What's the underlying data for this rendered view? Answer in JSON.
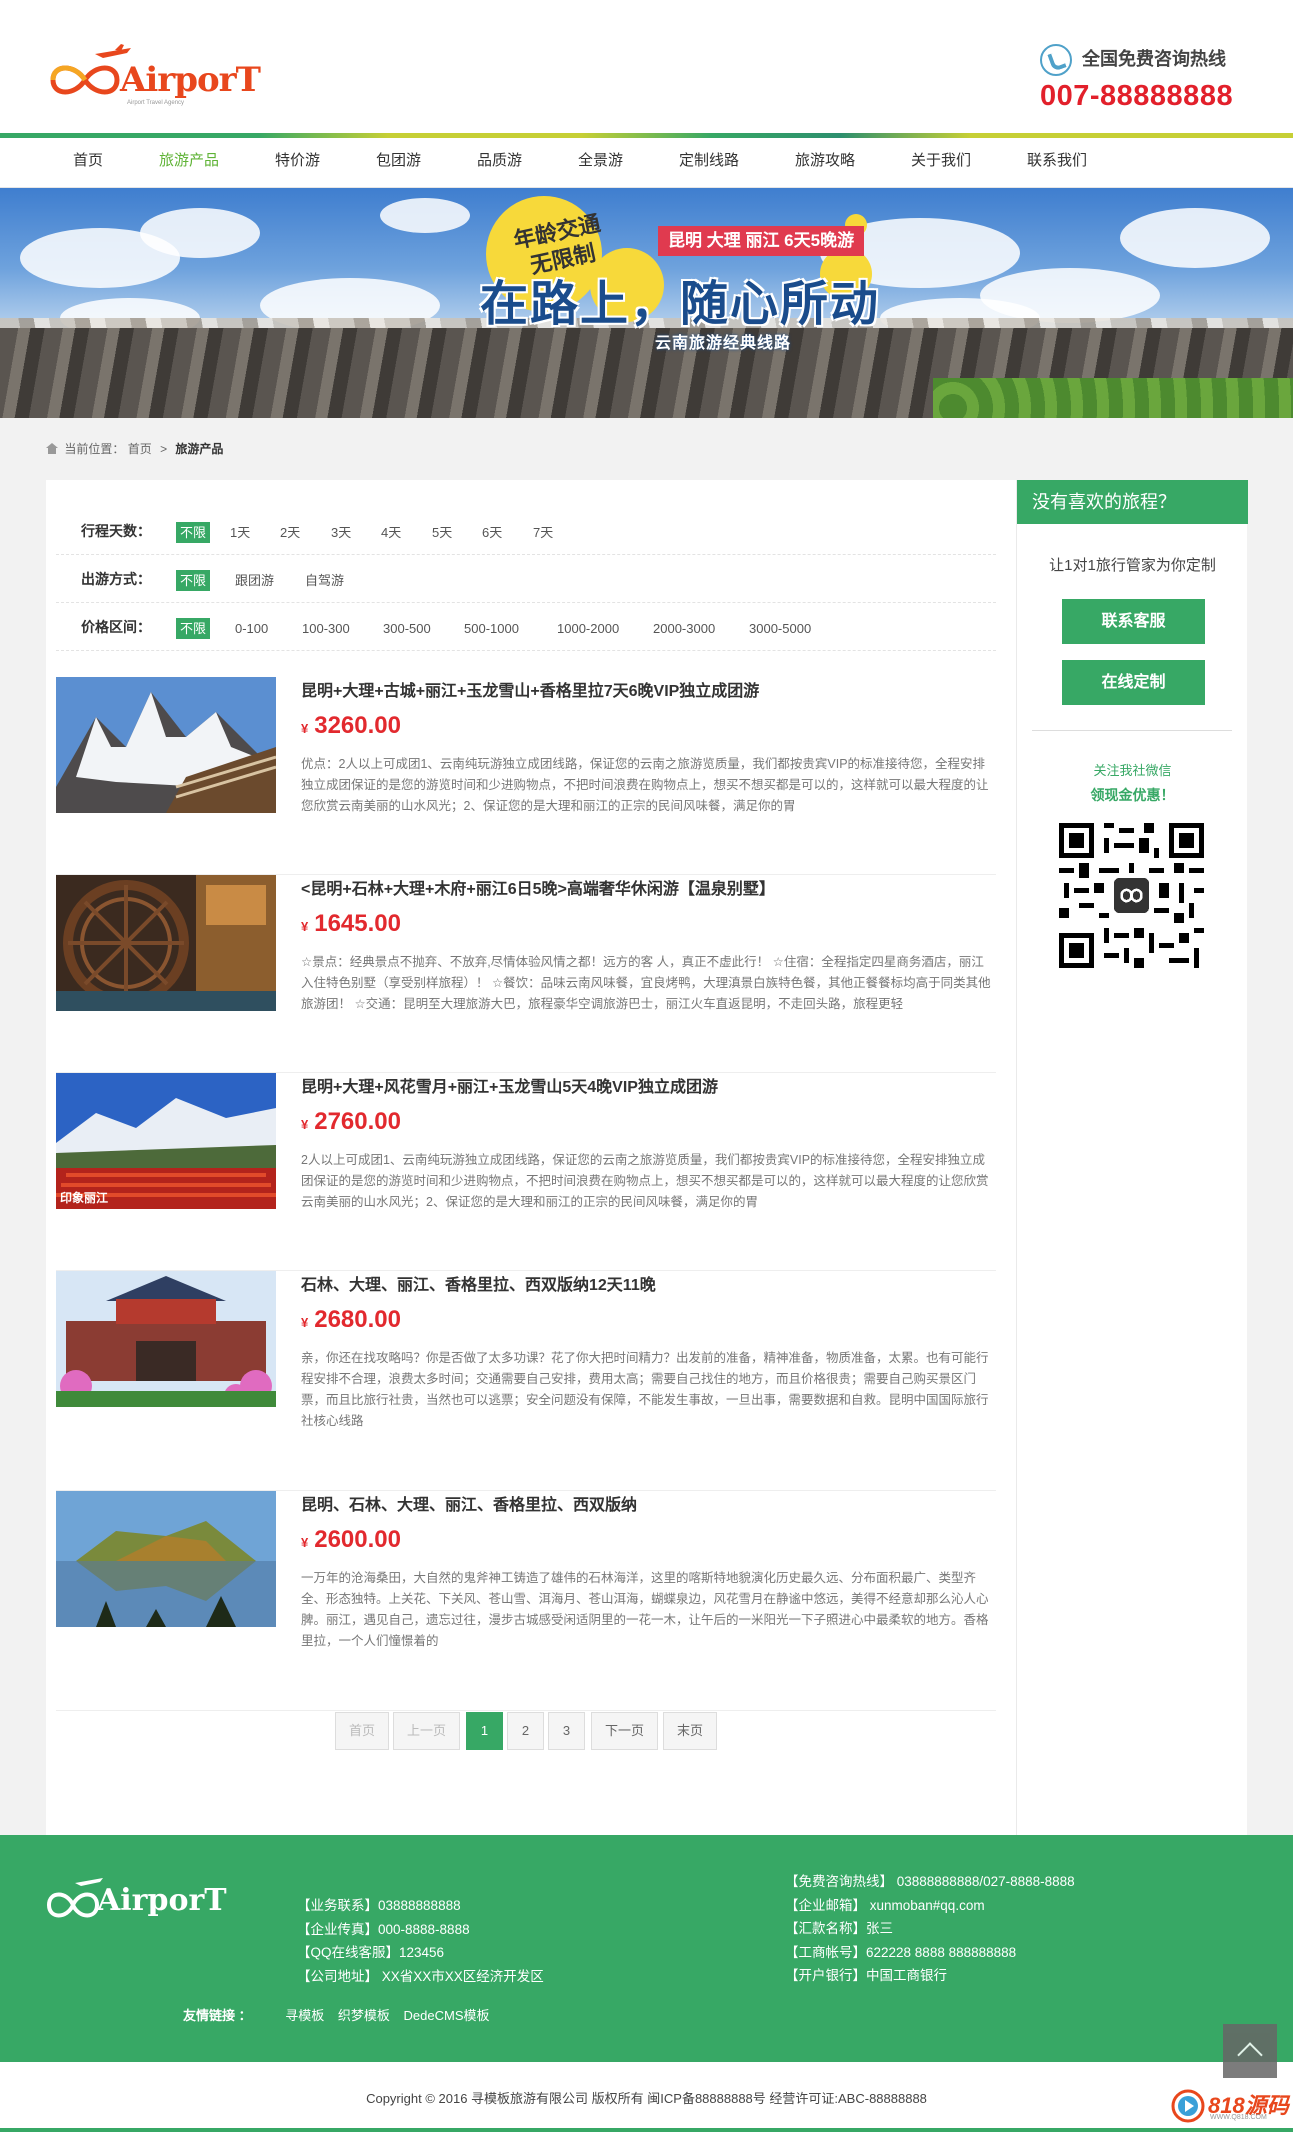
{
  "brand": {
    "logo_text": "AirporT",
    "logo_sub": "Airport Travel Agency",
    "footer_logo_text": "AirporT"
  },
  "header": {
    "hotline_label": "全国免费咨询热线",
    "hotline_number": "007-88888888"
  },
  "nav": [
    "首页",
    "旅游产品",
    "特价游",
    "包团游",
    "品质游",
    "全景游",
    "定制线路",
    "旅游攻略",
    "关于我们",
    "联系我们"
  ],
  "nav_active": "旅游产品",
  "banner": {
    "tag_line1": "年龄交通",
    "tag_line2": "无限制",
    "red_tag": "昆明 大理 丽江 6天5晚游",
    "main_title": "在路上，随心所动",
    "subtitle": "云南旅游经典线路"
  },
  "breadcrumb": {
    "prefix": "当前位置：",
    "home": "首页",
    "sep": ">",
    "current": "旅游产品"
  },
  "filters": [
    {
      "label": "行程天数：",
      "options": [
        "不限",
        "1天",
        "2天",
        "3天",
        "4天",
        "5天",
        "6天",
        "7天"
      ]
    },
    {
      "label": "出游方式：",
      "options": [
        "不限",
        "跟团游",
        "自驾游"
      ]
    },
    {
      "label": "价格区间：",
      "options": [
        "不限",
        "0-100",
        "100-300",
        "300-500",
        "500-1000",
        "1000-2000",
        "2000-3000",
        "3000-5000"
      ]
    }
  ],
  "products": [
    {
      "title": "昆明+大理+古城+丽江+玉龙雪山+香格里拉7天6晚VIP独立成团游",
      "currency": "¥",
      "price": "3260.00",
      "desc": "优点：2人以上可成团1、云南纯玩游独立成团线路，保证您的云南之旅游览质量，我们都按贵宾VIP的标准接待您，全程安排独立成团保证的是您的游览时间和少进购物点，不把时间浪费在购物点上，想买不想买都是可以的，这样就可以最大程度的让您欣赏云南美丽的山水风光；2、保证您的是大理和丽江的正宗的民间风味餐，满足你的胃"
    },
    {
      "title": "<昆明+石林+大理+木府+丽江6日5晚>高端奢华休闲游【温泉别墅】",
      "currency": "¥",
      "price": "1645.00",
      "desc": "☆景点：经典景点不抛弃、不放弃,尽情体验风情之都！远方的客 人，真正不虚此行！ ☆住宿：全程指定四星商务酒店，丽江入住特色别墅（享受别样旅程）！ ☆餐饮：品味云南风味餐，宜良烤鸭，大理滇景白族特色餐，其他正餐餐标均高于同类其他旅游团！ ☆交通：昆明至大理旅游大巴，旅程豪华空调旅游巴士，丽江火车直返昆明，不走回头路，旅程更轻"
    },
    {
      "title": "昆明+大理+风花雪月+丽江+玉龙雪山5天4晚VIP独立成团游",
      "currency": "¥",
      "price": "2760.00",
      "desc": "2人以上可成团1、云南纯玩游独立成团线路，保证您的云南之旅游览质量，我们都按贵宾VIP的标准接待您，全程安排独立成团保证的是您的游览时间和少进购物点，不把时间浪费在购物点上，想买不想买都是可以的，这样就可以最大程度的让您欣赏云南美丽的山水风光；2、保证您的是大理和丽江的正宗的民间风味餐，满足你的胃"
    },
    {
      "title": "石林、大理、丽江、香格里拉、西双版纳12天11晚",
      "currency": "¥",
      "price": "2680.00",
      "desc": "亲，你还在找攻略吗？你是否做了太多功课？花了你大把时间精力？出发前的准备，精神准备，物质准备，太累。也有可能行程安排不合理，浪费太多时间；交通需要自己安排，费用太高；需要自己找住的地方，而且价格很贵；需要自己购买景区门票，而且比旅行社贵，当然也可以逃票；安全问题没有保障，不能发生事故，一旦出事，需要数据和自救。昆明中国国际旅行社核心线路"
    },
    {
      "title": "昆明、石林、大理、丽江、香格里拉、西双版纳",
      "currency": "¥",
      "price": "2600.00",
      "desc": "一万年的沧海桑田，大自然的鬼斧神工铸造了雄伟的石林海洋，这里的喀斯特地貌演化历史最久远、分布面积最广、类型齐全、形态独特。上关花、下关风、苍山雪、洱海月、苍山洱海，蝴蝶泉边，风花雪月在静谧中悠远，美得不经意却那么沁人心脾。丽江，遇见自己，遗忘过往，漫步古城感受闲适阴里的一花一木，让午后的一米阳光一下子照进心中最柔软的地方。香格里拉，一个人们憧憬着的"
    }
  ],
  "product_image_caption": "印象丽江",
  "pagination": [
    "首页",
    "上一页",
    "1",
    "2",
    "3",
    "下一页",
    "末页"
  ],
  "pagination_current": "1",
  "sidebar": {
    "head": "没有喜欢的旅程？",
    "text": "让1对1旅行管家为你定制",
    "btn_service": "联系客服",
    "btn_custom": "在线定制",
    "wechat_line1": "关注我社微信",
    "wechat_line2": "领现金优惠！"
  },
  "footer": {
    "col1": [
      "【业务联系】03888888888",
      "【企业传真】000-8888-8888",
      "【QQ在线客服】123456",
      "【公司地址】 XX省XX市XX区经济开发区"
    ],
    "col2": [
      "【免费咨询热线】 03888888888/027-8888-8888",
      "【企业邮箱】 xunmoban#qq.com",
      "【汇款名称】张三",
      "【工商帐号】622228 8888 888888888",
      "【开户银行】中国工商银行"
    ],
    "links_label": "友情链接 ：",
    "links": [
      "寻模板",
      "织梦模板",
      "DedeCMS模板"
    ],
    "copyright": "Copyright © 2016   寻模板旅游有限公司    版权所有 闽ICP备88888888号    经营许可证:ABC-88888888"
  },
  "watermark": {
    "text": "818源码",
    "sub": "WWW.Q818.COM"
  },
  "colors": {
    "green": "#37a865",
    "red": "#e2202b",
    "price": "#e2292e"
  }
}
